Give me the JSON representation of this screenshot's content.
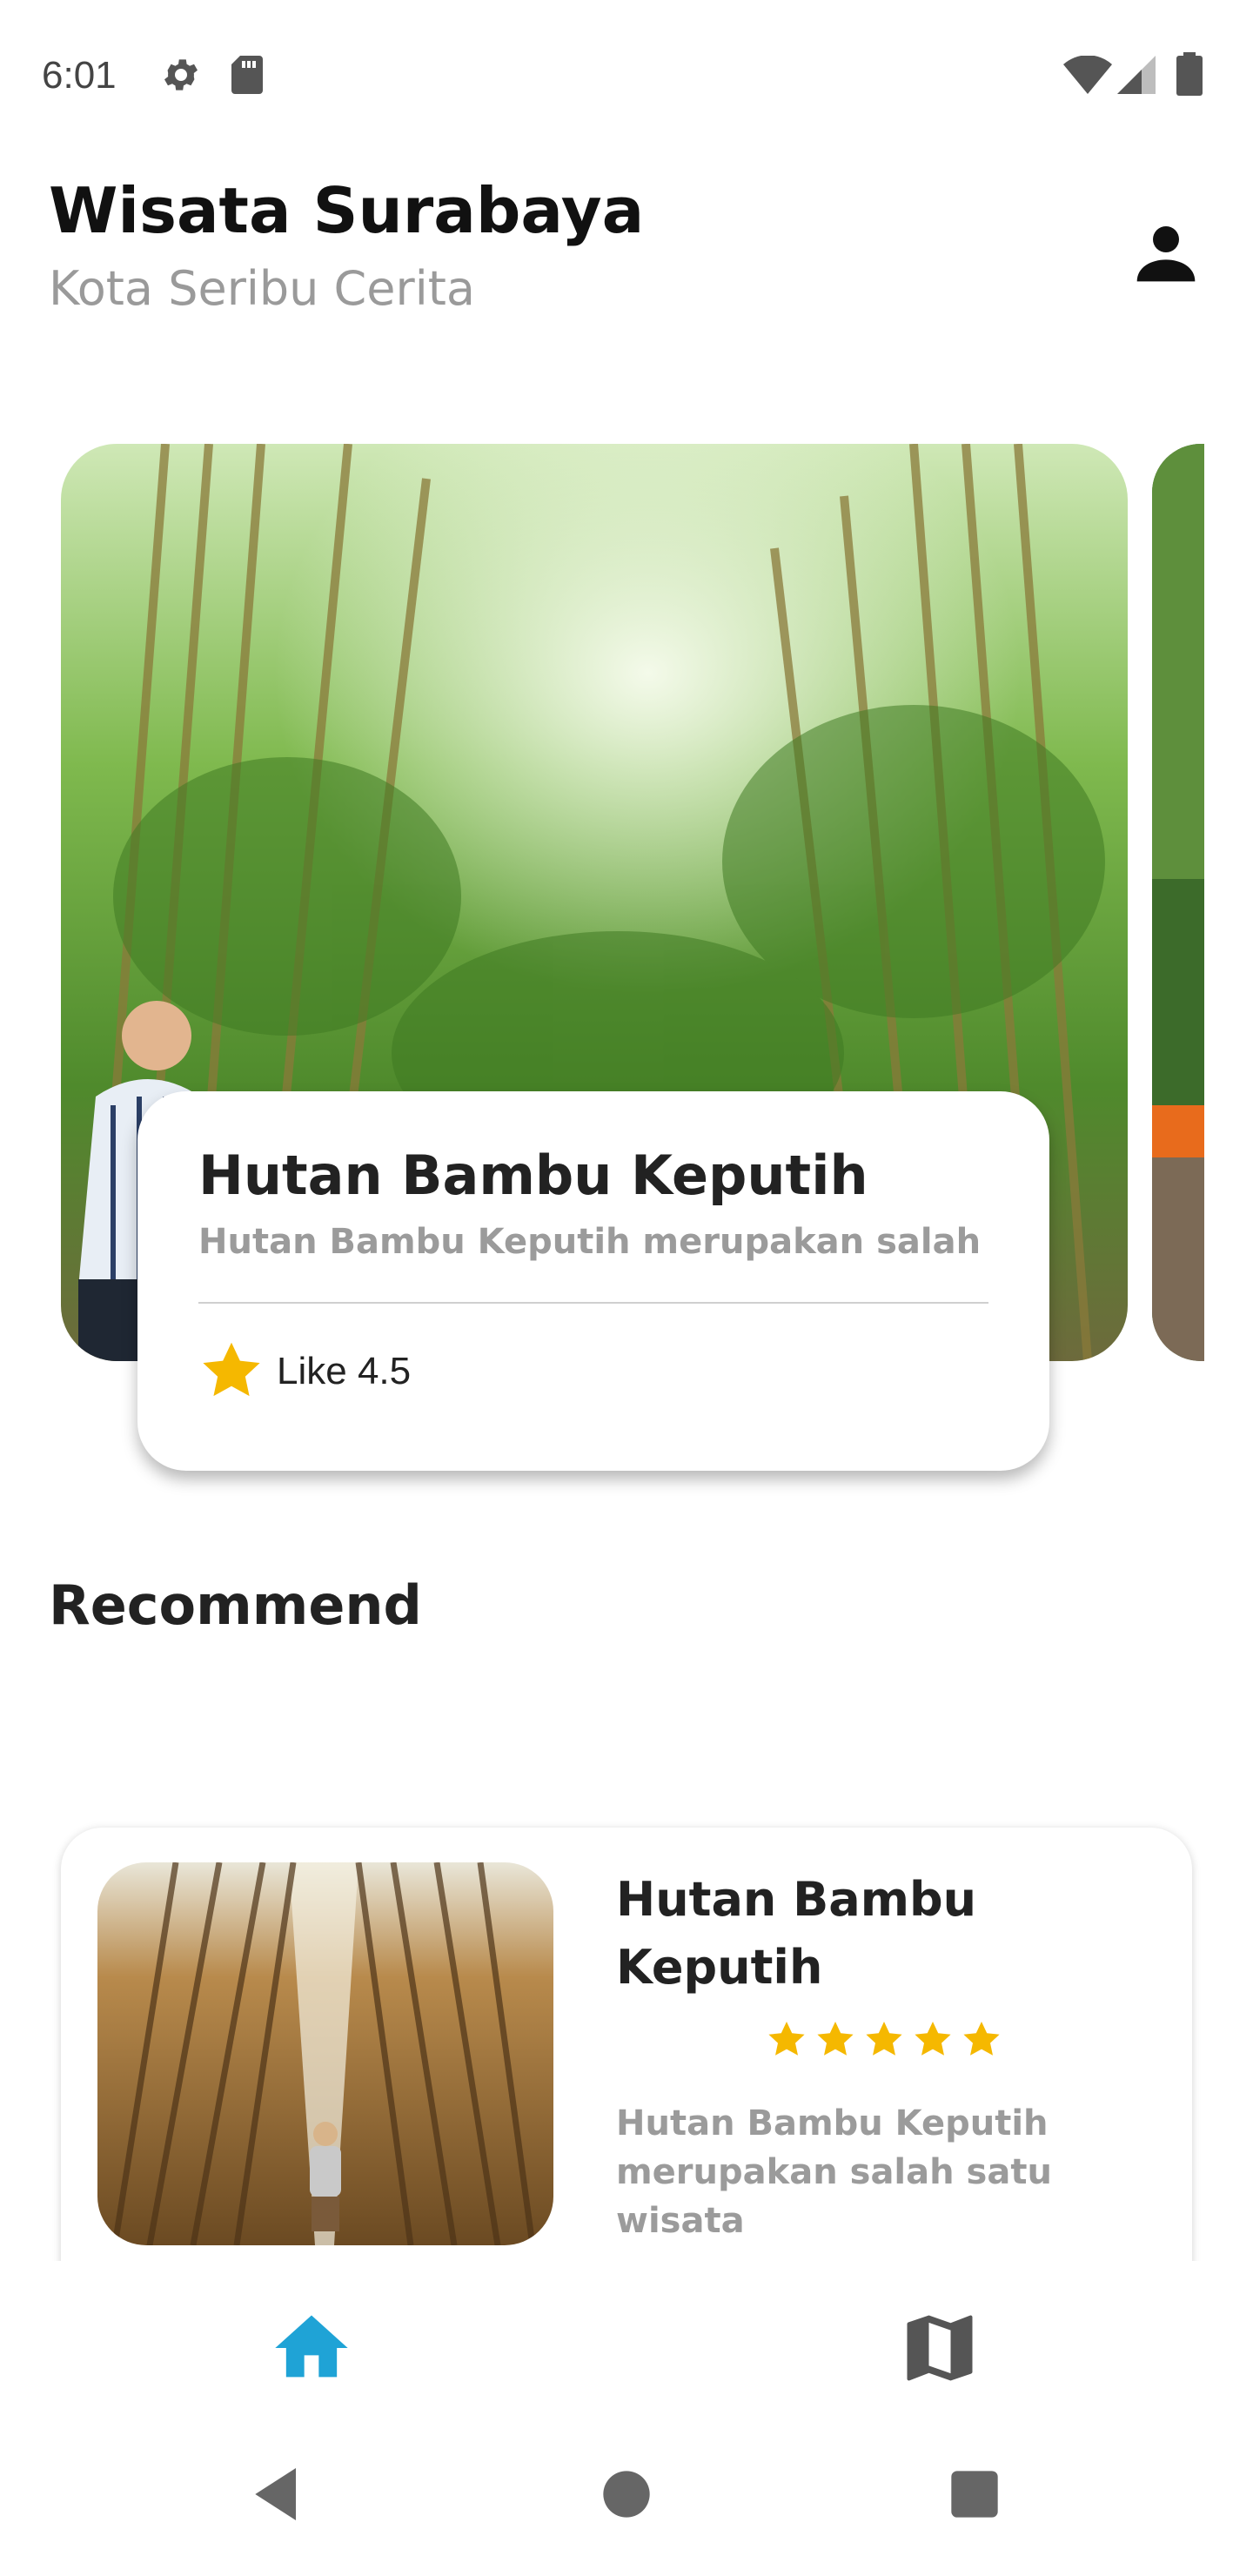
{
  "status_bar": {
    "time": "6:01",
    "icons": [
      "settings-icon",
      "sd-card-icon",
      "wifi-icon",
      "signal-icon",
      "battery-icon"
    ]
  },
  "header": {
    "title": "Wisata Surabaya",
    "subtitle": "Kota Seribu Cerita",
    "profile_icon": "person-icon"
  },
  "carousel": {
    "featured": {
      "title": "Hutan Bambu Keputih",
      "description": "Hutan Bambu Keputih merupakan salah",
      "rating_label": "Like 4.5",
      "rating_icon": "star-icon"
    }
  },
  "recommend": {
    "section_title": "Recommend",
    "items": [
      {
        "title": "Hutan Bambu Keputih",
        "stars": 5,
        "description": "Hutan Bambu Keputih merupakan salah satu wisata"
      }
    ]
  },
  "bottom_nav": {
    "items": [
      {
        "icon": "home-icon",
        "active": true
      },
      {
        "icon": "map-icon",
        "active": false
      }
    ],
    "active_color": "#1fa3d6",
    "inactive_color": "#555555"
  },
  "colors": {
    "star": "#f5b800",
    "subtitle": "#9a9a9a"
  }
}
